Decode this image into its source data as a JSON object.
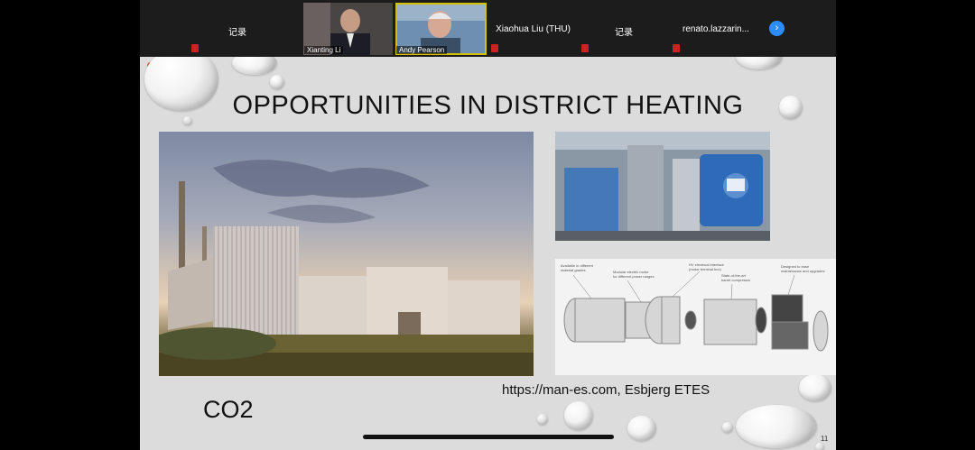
{
  "meeting": {
    "participants": [
      {
        "name": "记录",
        "video": false,
        "muted": true
      },
      {
        "name": "Xianting Li",
        "video": true,
        "muted": false
      },
      {
        "name": "Andy Pearson",
        "video": true,
        "muted": false,
        "active_speaker": true
      },
      {
        "name": "Xiaohua Liu (THU)",
        "video": false,
        "muted": true
      },
      {
        "name": "记录",
        "video": false,
        "muted": true
      },
      {
        "name": "renato.lazzarin...",
        "video": false,
        "muted": true
      }
    ],
    "next_icon": "chevron-right-icon"
  },
  "slide": {
    "title": "OPPORTUNITIES IN DISTRICT HEATING",
    "source": "https://man-es.com, Esbjerg ETES",
    "label": "CO2",
    "page_number": "11",
    "diagram_labels": [
      "Available in different\nmaterial grades",
      "Modular electric motor\nfor different power ranges",
      "HV electrical interface\n(motor terminal box)",
      "State-of-the-art\nbarrel compressor",
      "Designed to ease\nmaintenance and upgrades"
    ]
  },
  "colors": {
    "accent": "#2d8cff",
    "active_speaker": "#d7c000",
    "mute": "#cc2222"
  }
}
